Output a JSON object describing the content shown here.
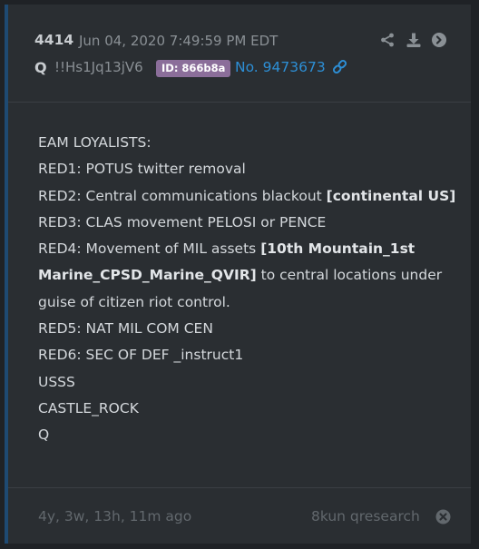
{
  "post": {
    "number": "4414",
    "date": "Jun 04, 2020 7:49:59 PM EDT",
    "author": "Q",
    "tripcode": "!!Hs1Jq13jV6",
    "id_badge": "ID: 866b8a",
    "post_link": "No. 9473673"
  },
  "body": {
    "line1": "EAM LOYALISTS:",
    "line2": "RED1: POTUS twitter removal",
    "line3_plain": "RED2: Central communications blackout ",
    "line3_bold": "[continental US]",
    "line4": "RED3: CLAS movement PELOSI or PENCE",
    "line5_plain": "RED4: Movement of MIL assets ",
    "line5_bold": "[10th Mountain_1st Marine_CPSD_Marine_QVIR]",
    "line5_tail": " to central locations under guise of citizen riot control.",
    "line6": "RED5: NAT MIL COM CEN",
    "line7": "RED6: SEC OF DEF _instruct1",
    "line8": "USSS",
    "line9": "CASTLE_ROCK",
    "line10": "Q"
  },
  "footer": {
    "ago": "4y, 3w, 13h, 11m ago",
    "source": "8kun qresearch"
  },
  "colors": {
    "accent": "#1e4a73",
    "id_badge": "#8b6e9a",
    "link": "#2d8fd6"
  },
  "icons": [
    "share-icon",
    "download-icon",
    "arrow-right-icon",
    "link-icon",
    "close-icon"
  ]
}
